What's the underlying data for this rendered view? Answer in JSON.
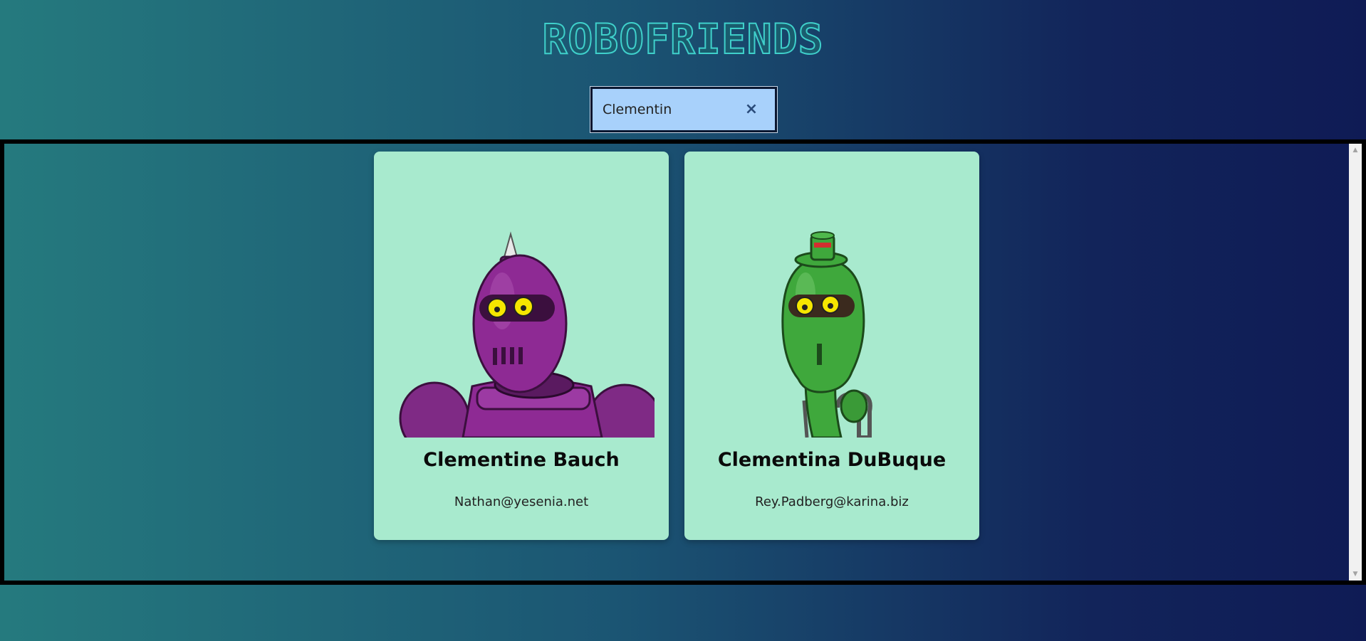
{
  "header": {
    "title": "ROBOFRIENDS"
  },
  "search": {
    "value": "Clementin",
    "clear_icon": "×"
  },
  "robots": [
    {
      "name": "Clementine Bauch",
      "email": "Nathan@yesenia.net",
      "image_icon": "purple-robot-avatar",
      "color": "#8e2a94"
    },
    {
      "name": "Clementina DuBuque",
      "email": "Rey.Padberg@karina.biz",
      "image_icon": "green-robot-avatar",
      "color": "#3fa83c"
    }
  ],
  "scrollbar": {
    "up_icon": "▲",
    "down_icon": "▼"
  },
  "colors": {
    "card_bg": "#a8eace",
    "title": "#3fd0cb",
    "search_bg": "#a8d1fb"
  }
}
